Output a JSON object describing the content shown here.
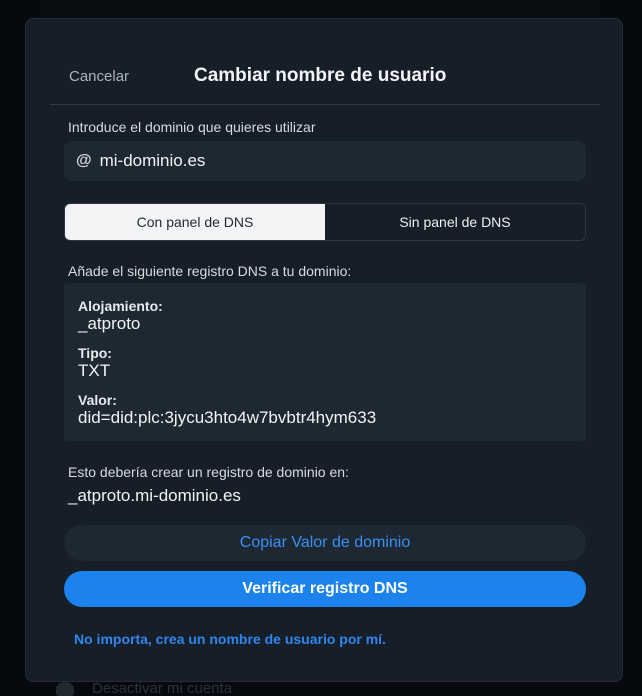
{
  "backdrop": {
    "item_label": "Desactivar mi cuenta"
  },
  "modal": {
    "cancel_label": "Cancelar",
    "title": "Cambiar nombre de usuario",
    "domain_prompt": "Introduce el dominio que quieres utilizar",
    "domain_value": "mi-dominio.es",
    "at_icon": "@",
    "tabs": [
      {
        "label": "Con panel de DNS",
        "active": true
      },
      {
        "label": "Sin panel de DNS",
        "active": false
      }
    ],
    "dns_instruction": "Añade el siguiente registro DNS a tu dominio:",
    "dns_record": {
      "host_label": "Alojamiento:",
      "host_value": "_atproto",
      "type_label": "Tipo:",
      "type_value": "TXT",
      "value_label": "Valor:",
      "value_value": "did=did:plc:3jycu3hto4w7bvbtr4hym633"
    },
    "result_label": "Esto debería crear un registro de dominio en:",
    "result_domain": "_atproto.mi-dominio.es",
    "copy_button": "Copiar Valor de dominio",
    "verify_button": "Verificar registro DNS",
    "skip_link": "No importa, crea un nombre de usuario por mí."
  },
  "colors": {
    "accent": "#1b82ee",
    "link": "#2f87ef",
    "modal_bg": "#161e27",
    "field_bg": "#1e2833"
  }
}
